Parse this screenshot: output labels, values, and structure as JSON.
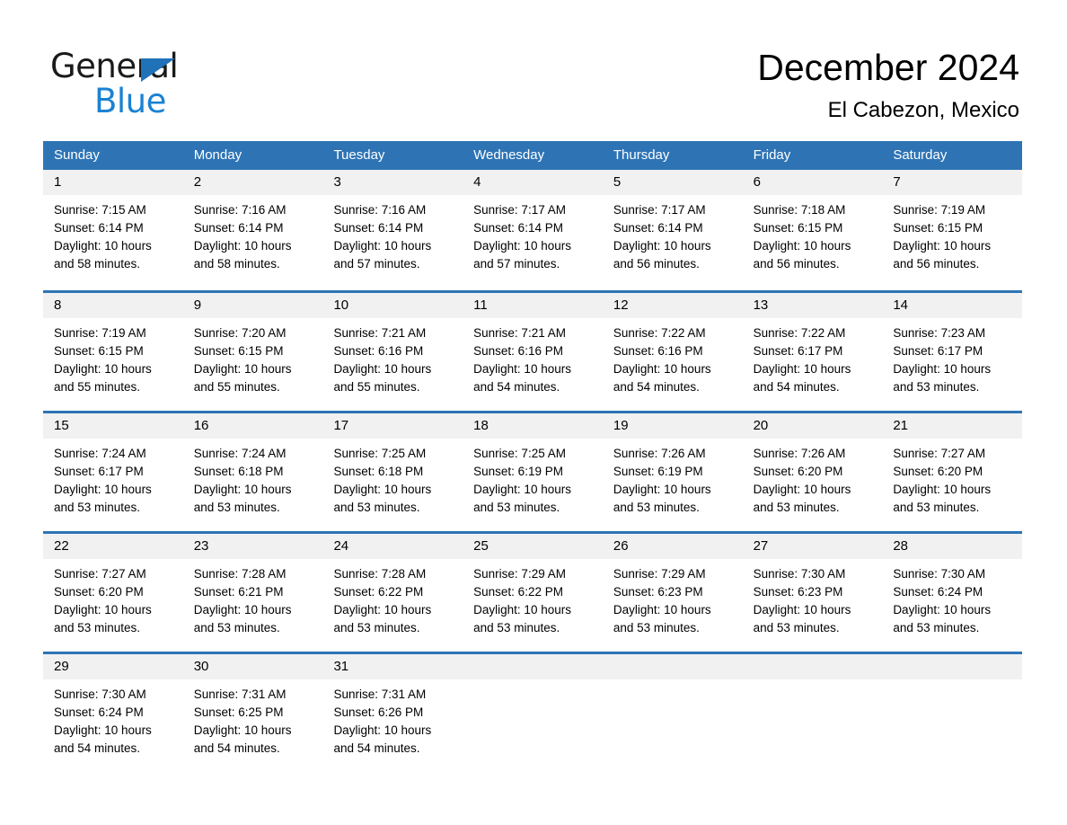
{
  "brand": {
    "name_top": "General",
    "name_bottom": "Blue",
    "triangle_icon": "brand-triangle-icon",
    "color_black": "#1a1a1a",
    "color_blue": "#1a82d2"
  },
  "header": {
    "title": "December 2024",
    "subtitle": "El Cabezon, Mexico"
  },
  "colors": {
    "header_blue": "#2e74b5",
    "day_band_gray": "#f1f1f1",
    "text": "#000000"
  },
  "weekdays": [
    "Sunday",
    "Monday",
    "Tuesday",
    "Wednesday",
    "Thursday",
    "Friday",
    "Saturday"
  ],
  "weeks": [
    [
      {
        "day": "1",
        "sunrise": "Sunrise: 7:15 AM",
        "sunset": "Sunset: 6:14 PM",
        "daylight_1": "Daylight: 10 hours",
        "daylight_2": "and 58 minutes."
      },
      {
        "day": "2",
        "sunrise": "Sunrise: 7:16 AM",
        "sunset": "Sunset: 6:14 PM",
        "daylight_1": "Daylight: 10 hours",
        "daylight_2": "and 58 minutes."
      },
      {
        "day": "3",
        "sunrise": "Sunrise: 7:16 AM",
        "sunset": "Sunset: 6:14 PM",
        "daylight_1": "Daylight: 10 hours",
        "daylight_2": "and 57 minutes."
      },
      {
        "day": "4",
        "sunrise": "Sunrise: 7:17 AM",
        "sunset": "Sunset: 6:14 PM",
        "daylight_1": "Daylight: 10 hours",
        "daylight_2": "and 57 minutes."
      },
      {
        "day": "5",
        "sunrise": "Sunrise: 7:17 AM",
        "sunset": "Sunset: 6:14 PM",
        "daylight_1": "Daylight: 10 hours",
        "daylight_2": "and 56 minutes."
      },
      {
        "day": "6",
        "sunrise": "Sunrise: 7:18 AM",
        "sunset": "Sunset: 6:15 PM",
        "daylight_1": "Daylight: 10 hours",
        "daylight_2": "and 56 minutes."
      },
      {
        "day": "7",
        "sunrise": "Sunrise: 7:19 AM",
        "sunset": "Sunset: 6:15 PM",
        "daylight_1": "Daylight: 10 hours",
        "daylight_2": "and 56 minutes."
      }
    ],
    [
      {
        "day": "8",
        "sunrise": "Sunrise: 7:19 AM",
        "sunset": "Sunset: 6:15 PM",
        "daylight_1": "Daylight: 10 hours",
        "daylight_2": "and 55 minutes."
      },
      {
        "day": "9",
        "sunrise": "Sunrise: 7:20 AM",
        "sunset": "Sunset: 6:15 PM",
        "daylight_1": "Daylight: 10 hours",
        "daylight_2": "and 55 minutes."
      },
      {
        "day": "10",
        "sunrise": "Sunrise: 7:21 AM",
        "sunset": "Sunset: 6:16 PM",
        "daylight_1": "Daylight: 10 hours",
        "daylight_2": "and 55 minutes."
      },
      {
        "day": "11",
        "sunrise": "Sunrise: 7:21 AM",
        "sunset": "Sunset: 6:16 PM",
        "daylight_1": "Daylight: 10 hours",
        "daylight_2": "and 54 minutes."
      },
      {
        "day": "12",
        "sunrise": "Sunrise: 7:22 AM",
        "sunset": "Sunset: 6:16 PM",
        "daylight_1": "Daylight: 10 hours",
        "daylight_2": "and 54 minutes."
      },
      {
        "day": "13",
        "sunrise": "Sunrise: 7:22 AM",
        "sunset": "Sunset: 6:17 PM",
        "daylight_1": "Daylight: 10 hours",
        "daylight_2": "and 54 minutes."
      },
      {
        "day": "14",
        "sunrise": "Sunrise: 7:23 AM",
        "sunset": "Sunset: 6:17 PM",
        "daylight_1": "Daylight: 10 hours",
        "daylight_2": "and 53 minutes."
      }
    ],
    [
      {
        "day": "15",
        "sunrise": "Sunrise: 7:24 AM",
        "sunset": "Sunset: 6:17 PM",
        "daylight_1": "Daylight: 10 hours",
        "daylight_2": "and 53 minutes."
      },
      {
        "day": "16",
        "sunrise": "Sunrise: 7:24 AM",
        "sunset": "Sunset: 6:18 PM",
        "daylight_1": "Daylight: 10 hours",
        "daylight_2": "and 53 minutes."
      },
      {
        "day": "17",
        "sunrise": "Sunrise: 7:25 AM",
        "sunset": "Sunset: 6:18 PM",
        "daylight_1": "Daylight: 10 hours",
        "daylight_2": "and 53 minutes."
      },
      {
        "day": "18",
        "sunrise": "Sunrise: 7:25 AM",
        "sunset": "Sunset: 6:19 PM",
        "daylight_1": "Daylight: 10 hours",
        "daylight_2": "and 53 minutes."
      },
      {
        "day": "19",
        "sunrise": "Sunrise: 7:26 AM",
        "sunset": "Sunset: 6:19 PM",
        "daylight_1": "Daylight: 10 hours",
        "daylight_2": "and 53 minutes."
      },
      {
        "day": "20",
        "sunrise": "Sunrise: 7:26 AM",
        "sunset": "Sunset: 6:20 PM",
        "daylight_1": "Daylight: 10 hours",
        "daylight_2": "and 53 minutes."
      },
      {
        "day": "21",
        "sunrise": "Sunrise: 7:27 AM",
        "sunset": "Sunset: 6:20 PM",
        "daylight_1": "Daylight: 10 hours",
        "daylight_2": "and 53 minutes."
      }
    ],
    [
      {
        "day": "22",
        "sunrise": "Sunrise: 7:27 AM",
        "sunset": "Sunset: 6:20 PM",
        "daylight_1": "Daylight: 10 hours",
        "daylight_2": "and 53 minutes."
      },
      {
        "day": "23",
        "sunrise": "Sunrise: 7:28 AM",
        "sunset": "Sunset: 6:21 PM",
        "daylight_1": "Daylight: 10 hours",
        "daylight_2": "and 53 minutes."
      },
      {
        "day": "24",
        "sunrise": "Sunrise: 7:28 AM",
        "sunset": "Sunset: 6:22 PM",
        "daylight_1": "Daylight: 10 hours",
        "daylight_2": "and 53 minutes."
      },
      {
        "day": "25",
        "sunrise": "Sunrise: 7:29 AM",
        "sunset": "Sunset: 6:22 PM",
        "daylight_1": "Daylight: 10 hours",
        "daylight_2": "and 53 minutes."
      },
      {
        "day": "26",
        "sunrise": "Sunrise: 7:29 AM",
        "sunset": "Sunset: 6:23 PM",
        "daylight_1": "Daylight: 10 hours",
        "daylight_2": "and 53 minutes."
      },
      {
        "day": "27",
        "sunrise": "Sunrise: 7:30 AM",
        "sunset": "Sunset: 6:23 PM",
        "daylight_1": "Daylight: 10 hours",
        "daylight_2": "and 53 minutes."
      },
      {
        "day": "28",
        "sunrise": "Sunrise: 7:30 AM",
        "sunset": "Sunset: 6:24 PM",
        "daylight_1": "Daylight: 10 hours",
        "daylight_2": "and 53 minutes."
      }
    ],
    [
      {
        "day": "29",
        "sunrise": "Sunrise: 7:30 AM",
        "sunset": "Sunset: 6:24 PM",
        "daylight_1": "Daylight: 10 hours",
        "daylight_2": "and 54 minutes."
      },
      {
        "day": "30",
        "sunrise": "Sunrise: 7:31 AM",
        "sunset": "Sunset: 6:25 PM",
        "daylight_1": "Daylight: 10 hours",
        "daylight_2": "and 54 minutes."
      },
      {
        "day": "31",
        "sunrise": "Sunrise: 7:31 AM",
        "sunset": "Sunset: 6:26 PM",
        "daylight_1": "Daylight: 10 hours",
        "daylight_2": "and 54 minutes."
      },
      {
        "day": "",
        "sunrise": "",
        "sunset": "",
        "daylight_1": "",
        "daylight_2": ""
      },
      {
        "day": "",
        "sunrise": "",
        "sunset": "",
        "daylight_1": "",
        "daylight_2": ""
      },
      {
        "day": "",
        "sunrise": "",
        "sunset": "",
        "daylight_1": "",
        "daylight_2": ""
      },
      {
        "day": "",
        "sunrise": "",
        "sunset": "",
        "daylight_1": "",
        "daylight_2": ""
      }
    ]
  ]
}
